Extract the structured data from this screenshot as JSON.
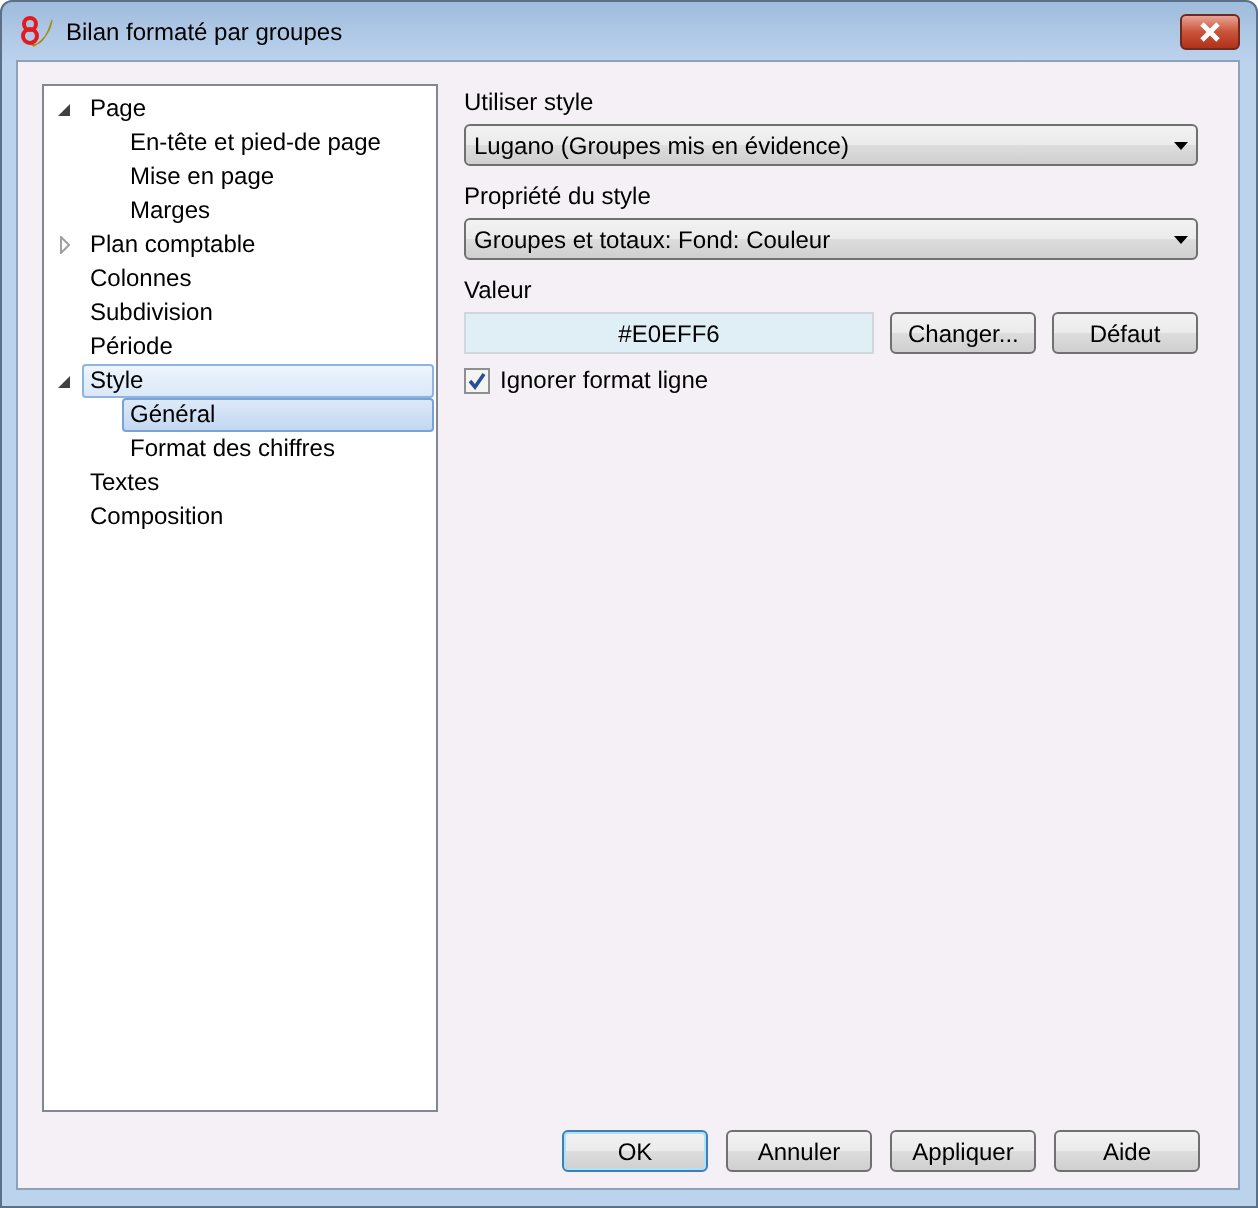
{
  "window": {
    "title": "Bilan formaté par groupes"
  },
  "tree": [
    {
      "label": "Page",
      "expanded": true,
      "selected": false,
      "hovered": false,
      "children": [
        {
          "label": "En-tête et pied-de page",
          "selected": false,
          "hovered": false
        },
        {
          "label": "Mise en page",
          "selected": false,
          "hovered": false
        },
        {
          "label": "Marges",
          "selected": false,
          "hovered": false
        }
      ]
    },
    {
      "label": "Plan comptable",
      "expanded": false,
      "selected": false,
      "hovered": false
    },
    {
      "label": "Colonnes",
      "selected": false,
      "hovered": false
    },
    {
      "label": "Subdivision",
      "selected": false,
      "hovered": false
    },
    {
      "label": "Période",
      "selected": false,
      "hovered": false
    },
    {
      "label": "Style",
      "expanded": true,
      "selected": false,
      "hovered": true,
      "children": [
        {
          "label": "Général",
          "selected": true,
          "hovered": false
        },
        {
          "label": "Format des chiffres",
          "selected": false,
          "hovered": false
        }
      ]
    },
    {
      "label": "Textes",
      "selected": false,
      "hovered": false
    },
    {
      "label": "Composition",
      "selected": false,
      "hovered": false
    }
  ],
  "form": {
    "style_label": "Utiliser style",
    "style_value": "Lugano (Groupes mis en évidence)",
    "property_label": "Propriété du style",
    "property_value": "Groupes et totaux: Fond: Couleur",
    "value_label": "Valeur",
    "value": "#E0EFF6",
    "change_button": "Changer...",
    "default_button": "Défaut",
    "ignore_checkbox": {
      "label": "Ignorer format ligne",
      "checked": true
    }
  },
  "buttons": [
    {
      "label": "OK",
      "default": true
    },
    {
      "label": "Annuler",
      "default": false
    },
    {
      "label": "Appliquer",
      "default": false
    },
    {
      "label": "Aide",
      "default": false
    }
  ]
}
